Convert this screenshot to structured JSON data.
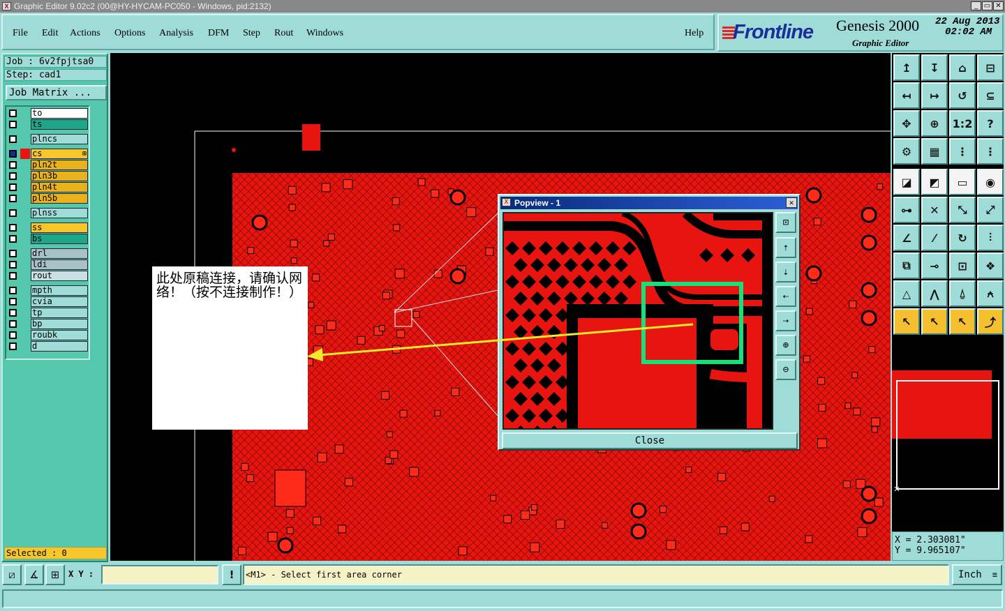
{
  "window": {
    "title": "Graphic Editor 9.02c2 (00@HY-HYCAM-PC050 - Windows, pid:2132)",
    "icon": "x-app-icon",
    "controls": [
      "_",
      "▭",
      "✕"
    ]
  },
  "menubar": {
    "items": [
      "File",
      "Edit",
      "Actions",
      "Options",
      "Analysis",
      "DFM",
      "Step",
      "Rout",
      "Windows"
    ],
    "help": "Help"
  },
  "logo": {
    "brand": "Frontline",
    "product": "Genesis 2000",
    "subtitle": "Graphic Editor",
    "date": "22 Aug 2013",
    "time": "02:02 AM",
    "brand_color": "#1a2f9c",
    "accent_color": "#e52620"
  },
  "job": {
    "job_label": "Job : 6v2fpjtsa0",
    "step_label": "Step: cad1",
    "matrix_button": "Job Matrix ..."
  },
  "layers": [
    {
      "name": "to",
      "color": "#ffffff",
      "active": false,
      "extra": ""
    },
    {
      "name": "ts",
      "color": "#1fa58a",
      "active": false,
      "extra": ""
    },
    {
      "name": "plncs",
      "color": "#9fdcd8",
      "active": false,
      "extra": ""
    },
    {
      "name": "cs",
      "color": "#f7c62b",
      "active": true,
      "extra": "⊞"
    },
    {
      "name": "pln2t",
      "color": "#e9b21d",
      "active": false,
      "extra": ""
    },
    {
      "name": "pln3b",
      "color": "#e9b21d",
      "active": false,
      "extra": ""
    },
    {
      "name": "pln4t",
      "color": "#e9b21d",
      "active": false,
      "extra": ""
    },
    {
      "name": "pln5b",
      "color": "#e9b21d",
      "active": false,
      "extra": ""
    },
    {
      "name": "plnss",
      "color": "#9fdcd8",
      "active": false,
      "extra": ""
    },
    {
      "name": "ss",
      "color": "#f7c62b",
      "active": false,
      "extra": ""
    },
    {
      "name": "bs",
      "color": "#1fa58a",
      "active": false,
      "extra": ""
    },
    {
      "name": "drl",
      "color": "#a9c2c8",
      "active": false,
      "extra": ""
    },
    {
      "name": "ldi",
      "color": "#a9c2c8",
      "active": false,
      "extra": ""
    },
    {
      "name": "rout",
      "color": "#c9dfe2",
      "active": false,
      "extra": ""
    },
    {
      "name": "mpth",
      "color": "#9fdcd8",
      "active": false,
      "extra": ""
    },
    {
      "name": "cvia",
      "color": "#9fdcd8",
      "active": false,
      "extra": ""
    },
    {
      "name": "tp",
      "color": "#9fdcd8",
      "active": false,
      "extra": ""
    },
    {
      "name": "bp",
      "color": "#9fdcd8",
      "active": false,
      "extra": ""
    },
    {
      "name": "roubk",
      "color": "#9fdcd8",
      "active": false,
      "extra": ""
    },
    {
      "name": "d",
      "color": "#9fdcd8",
      "active": false,
      "extra": ""
    }
  ],
  "selected": "Selected : 0",
  "annotation": {
    "text": "此处原稿连接，请确认网络！（按不连接制作！）",
    "arrow_color": "#f2ea2a",
    "highlight_color": "#16e07a"
  },
  "popview": {
    "title": "Popview - 1",
    "close_label": "Close",
    "side_buttons": [
      "zoom-home-icon",
      "pan-up-icon",
      "pan-down-icon",
      "pan-left-icon",
      "pan-right-icon",
      "zoom-in-icon",
      "zoom-out-icon"
    ]
  },
  "tools": {
    "rows": [
      [
        "↥",
        "↧",
        "⌂",
        "⊟"
      ],
      [
        "↤",
        "↦",
        "↺",
        "⊆"
      ],
      [
        "✥",
        "⊕",
        "1:2",
        "?"
      ],
      [
        "⚙",
        "▦",
        "⋮",
        "⋮"
      ],
      [
        "◪",
        "◩",
        "▭",
        "◉"
      ],
      [
        "⊶",
        "✕",
        "⤡",
        "⤢"
      ],
      [
        "∠",
        "⁄",
        "↻",
        "⫶"
      ],
      [
        "⧉",
        "⊸",
        "⊡",
        "❖"
      ],
      [
        "△",
        "⋀",
        "⍙",
        "⍲"
      ],
      [
        "↖",
        "↖",
        "↖",
        "⤴"
      ]
    ],
    "row_styles": [
      "",
      "",
      "",
      "",
      "white",
      "",
      "",
      "",
      "",
      "yellow"
    ]
  },
  "coords": {
    "x": "X = 2.303081\"",
    "y": "Y = 9.965107\""
  },
  "bottom": {
    "xy_label": "X Y :",
    "xy_value": "",
    "info_button": "!",
    "prompt": "<M1> - Select first area corner",
    "units": "Inch",
    "units_icon": "dropdown-icon"
  }
}
